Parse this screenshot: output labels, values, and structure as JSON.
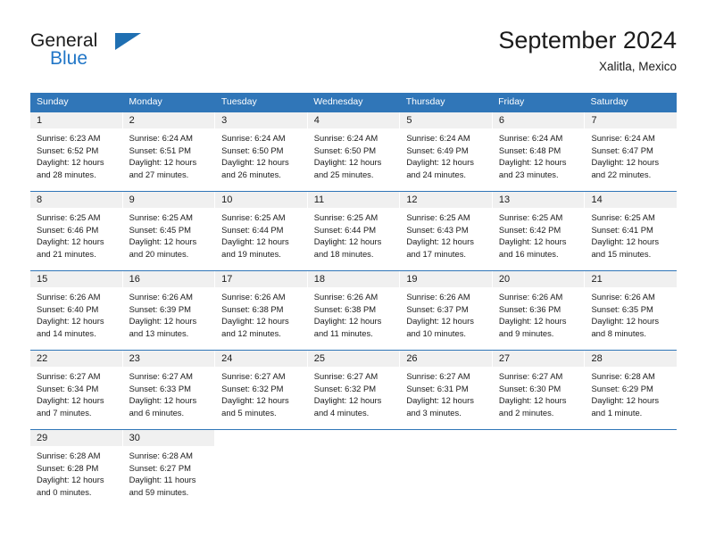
{
  "logo": {
    "primary_text": "General",
    "secondary_text": "Blue",
    "primary_color": "#1b1b1b",
    "secondary_color": "#2176c7",
    "triangle_color": "#1f6fb2"
  },
  "header": {
    "title": "September 2024",
    "subtitle": "Xalitla, Mexico"
  },
  "theme": {
    "header_blue": "#3076b8",
    "day_number_bg": "#f0f0f0",
    "text_color": "#1b1b1b"
  },
  "weekdays": [
    "Sunday",
    "Monday",
    "Tuesday",
    "Wednesday",
    "Thursday",
    "Friday",
    "Saturday"
  ],
  "weeks": [
    [
      {
        "day": "1",
        "sunrise": "Sunrise: 6:23 AM",
        "sunset": "Sunset: 6:52 PM",
        "daylight_line1": "Daylight: 12 hours",
        "daylight_line2": "and 28 minutes."
      },
      {
        "day": "2",
        "sunrise": "Sunrise: 6:24 AM",
        "sunset": "Sunset: 6:51 PM",
        "daylight_line1": "Daylight: 12 hours",
        "daylight_line2": "and 27 minutes."
      },
      {
        "day": "3",
        "sunrise": "Sunrise: 6:24 AM",
        "sunset": "Sunset: 6:50 PM",
        "daylight_line1": "Daylight: 12 hours",
        "daylight_line2": "and 26 minutes."
      },
      {
        "day": "4",
        "sunrise": "Sunrise: 6:24 AM",
        "sunset": "Sunset: 6:50 PM",
        "daylight_line1": "Daylight: 12 hours",
        "daylight_line2": "and 25 minutes."
      },
      {
        "day": "5",
        "sunrise": "Sunrise: 6:24 AM",
        "sunset": "Sunset: 6:49 PM",
        "daylight_line1": "Daylight: 12 hours",
        "daylight_line2": "and 24 minutes."
      },
      {
        "day": "6",
        "sunrise": "Sunrise: 6:24 AM",
        "sunset": "Sunset: 6:48 PM",
        "daylight_line1": "Daylight: 12 hours",
        "daylight_line2": "and 23 minutes."
      },
      {
        "day": "7",
        "sunrise": "Sunrise: 6:24 AM",
        "sunset": "Sunset: 6:47 PM",
        "daylight_line1": "Daylight: 12 hours",
        "daylight_line2": "and 22 minutes."
      }
    ],
    [
      {
        "day": "8",
        "sunrise": "Sunrise: 6:25 AM",
        "sunset": "Sunset: 6:46 PM",
        "daylight_line1": "Daylight: 12 hours",
        "daylight_line2": "and 21 minutes."
      },
      {
        "day": "9",
        "sunrise": "Sunrise: 6:25 AM",
        "sunset": "Sunset: 6:45 PM",
        "daylight_line1": "Daylight: 12 hours",
        "daylight_line2": "and 20 minutes."
      },
      {
        "day": "10",
        "sunrise": "Sunrise: 6:25 AM",
        "sunset": "Sunset: 6:44 PM",
        "daylight_line1": "Daylight: 12 hours",
        "daylight_line2": "and 19 minutes."
      },
      {
        "day": "11",
        "sunrise": "Sunrise: 6:25 AM",
        "sunset": "Sunset: 6:44 PM",
        "daylight_line1": "Daylight: 12 hours",
        "daylight_line2": "and 18 minutes."
      },
      {
        "day": "12",
        "sunrise": "Sunrise: 6:25 AM",
        "sunset": "Sunset: 6:43 PM",
        "daylight_line1": "Daylight: 12 hours",
        "daylight_line2": "and 17 minutes."
      },
      {
        "day": "13",
        "sunrise": "Sunrise: 6:25 AM",
        "sunset": "Sunset: 6:42 PM",
        "daylight_line1": "Daylight: 12 hours",
        "daylight_line2": "and 16 minutes."
      },
      {
        "day": "14",
        "sunrise": "Sunrise: 6:25 AM",
        "sunset": "Sunset: 6:41 PM",
        "daylight_line1": "Daylight: 12 hours",
        "daylight_line2": "and 15 minutes."
      }
    ],
    [
      {
        "day": "15",
        "sunrise": "Sunrise: 6:26 AM",
        "sunset": "Sunset: 6:40 PM",
        "daylight_line1": "Daylight: 12 hours",
        "daylight_line2": "and 14 minutes."
      },
      {
        "day": "16",
        "sunrise": "Sunrise: 6:26 AM",
        "sunset": "Sunset: 6:39 PM",
        "daylight_line1": "Daylight: 12 hours",
        "daylight_line2": "and 13 minutes."
      },
      {
        "day": "17",
        "sunrise": "Sunrise: 6:26 AM",
        "sunset": "Sunset: 6:38 PM",
        "daylight_line1": "Daylight: 12 hours",
        "daylight_line2": "and 12 minutes."
      },
      {
        "day": "18",
        "sunrise": "Sunrise: 6:26 AM",
        "sunset": "Sunset: 6:38 PM",
        "daylight_line1": "Daylight: 12 hours",
        "daylight_line2": "and 11 minutes."
      },
      {
        "day": "19",
        "sunrise": "Sunrise: 6:26 AM",
        "sunset": "Sunset: 6:37 PM",
        "daylight_line1": "Daylight: 12 hours",
        "daylight_line2": "and 10 minutes."
      },
      {
        "day": "20",
        "sunrise": "Sunrise: 6:26 AM",
        "sunset": "Sunset: 6:36 PM",
        "daylight_line1": "Daylight: 12 hours",
        "daylight_line2": "and 9 minutes."
      },
      {
        "day": "21",
        "sunrise": "Sunrise: 6:26 AM",
        "sunset": "Sunset: 6:35 PM",
        "daylight_line1": "Daylight: 12 hours",
        "daylight_line2": "and 8 minutes."
      }
    ],
    [
      {
        "day": "22",
        "sunrise": "Sunrise: 6:27 AM",
        "sunset": "Sunset: 6:34 PM",
        "daylight_line1": "Daylight: 12 hours",
        "daylight_line2": "and 7 minutes."
      },
      {
        "day": "23",
        "sunrise": "Sunrise: 6:27 AM",
        "sunset": "Sunset: 6:33 PM",
        "daylight_line1": "Daylight: 12 hours",
        "daylight_line2": "and 6 minutes."
      },
      {
        "day": "24",
        "sunrise": "Sunrise: 6:27 AM",
        "sunset": "Sunset: 6:32 PM",
        "daylight_line1": "Daylight: 12 hours",
        "daylight_line2": "and 5 minutes."
      },
      {
        "day": "25",
        "sunrise": "Sunrise: 6:27 AM",
        "sunset": "Sunset: 6:32 PM",
        "daylight_line1": "Daylight: 12 hours",
        "daylight_line2": "and 4 minutes."
      },
      {
        "day": "26",
        "sunrise": "Sunrise: 6:27 AM",
        "sunset": "Sunset: 6:31 PM",
        "daylight_line1": "Daylight: 12 hours",
        "daylight_line2": "and 3 minutes."
      },
      {
        "day": "27",
        "sunrise": "Sunrise: 6:27 AM",
        "sunset": "Sunset: 6:30 PM",
        "daylight_line1": "Daylight: 12 hours",
        "daylight_line2": "and 2 minutes."
      },
      {
        "day": "28",
        "sunrise": "Sunrise: 6:28 AM",
        "sunset": "Sunset: 6:29 PM",
        "daylight_line1": "Daylight: 12 hours",
        "daylight_line2": "and 1 minute."
      }
    ],
    [
      {
        "day": "29",
        "sunrise": "Sunrise: 6:28 AM",
        "sunset": "Sunset: 6:28 PM",
        "daylight_line1": "Daylight: 12 hours",
        "daylight_line2": "and 0 minutes."
      },
      {
        "day": "30",
        "sunrise": "Sunrise: 6:28 AM",
        "sunset": "Sunset: 6:27 PM",
        "daylight_line1": "Daylight: 11 hours",
        "daylight_line2": "and 59 minutes."
      },
      {
        "day": "",
        "sunrise": "",
        "sunset": "",
        "daylight_line1": "",
        "daylight_line2": ""
      },
      {
        "day": "",
        "sunrise": "",
        "sunset": "",
        "daylight_line1": "",
        "daylight_line2": ""
      },
      {
        "day": "",
        "sunrise": "",
        "sunset": "",
        "daylight_line1": "",
        "daylight_line2": ""
      },
      {
        "day": "",
        "sunrise": "",
        "sunset": "",
        "daylight_line1": "",
        "daylight_line2": ""
      },
      {
        "day": "",
        "sunrise": "",
        "sunset": "",
        "daylight_line1": "",
        "daylight_line2": ""
      }
    ]
  ]
}
